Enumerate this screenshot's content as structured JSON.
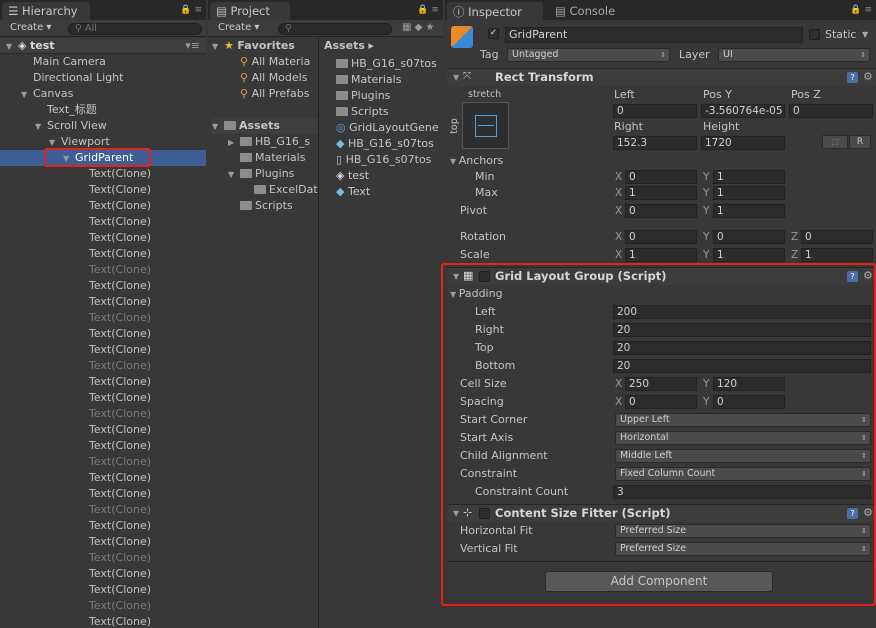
{
  "hierarchy": {
    "tab": "Hierarchy",
    "create": "Create",
    "search_placeholder": "All",
    "scene": "test",
    "items": {
      "main_camera": "Main Camera",
      "directional_light": "Directional Light",
      "canvas": "Canvas",
      "text_title": "Text_标题",
      "scroll_view": "Scroll View",
      "viewport": "Viewport",
      "grid_parent": "GridParent"
    },
    "clone_label": "Text(Clone)"
  },
  "project": {
    "tab": "Project",
    "create": "Create",
    "favorites": "Favorites",
    "fav_items": [
      "All Materia",
      "All Models",
      "All Prefabs"
    ],
    "assets": "Assets",
    "tree": [
      "HB_G16_s",
      "Materials",
      "Plugins",
      "ExcelDat",
      "Scripts"
    ],
    "breadcrumb": "Assets",
    "list": [
      "HB_G16_s07tos",
      "Materials",
      "Plugins",
      "Scripts",
      "GridLayoutGene",
      "HB_G16_s07tos",
      "HB_G16_s07tos",
      "test",
      "Text"
    ]
  },
  "inspector": {
    "tab": "Inspector",
    "console_tab": "Console",
    "object_name": "GridParent",
    "static_label": "Static",
    "tag_label": "Tag",
    "tag_value": "Untagged",
    "layer_label": "Layer",
    "layer_value": "UI",
    "rect": {
      "title": "Rect Transform",
      "stretch": "stretch",
      "top": "top",
      "col_left": "Left",
      "col_posy": "Pos Y",
      "col_posz": "Pos Z",
      "left": "0",
      "posy": "-3.560764e-05",
      "posz": "0",
      "col_right": "Right",
      "col_height": "Height",
      "right": "152.3",
      "height": "1720",
      "r_btn": "R",
      "anchors": "Anchors",
      "min": "Min",
      "max": "Max",
      "pivot": "Pivot",
      "rotation": "Rotation",
      "scale": "Scale",
      "min_x": "0",
      "min_y": "1",
      "max_x": "1",
      "max_y": "1",
      "pivot_x": "0",
      "pivot_y": "1",
      "rot_x": "0",
      "rot_y": "0",
      "rot_z": "0",
      "scale_x": "1",
      "scale_y": "1",
      "scale_z": "1"
    },
    "grid": {
      "title": "Grid Layout Group (Script)",
      "padding": "Padding",
      "left_label": "Left",
      "left": "200",
      "right_label": "Right",
      "right": "20",
      "top_label": "Top",
      "top": "20",
      "bottom_label": "Bottom",
      "bottom": "20",
      "cell_size": "Cell Size",
      "cell_x": "250",
      "cell_y": "120",
      "spacing": "Spacing",
      "spacing_x": "0",
      "spacing_y": "0",
      "start_corner": "Start Corner",
      "start_corner_value": "Upper Left",
      "start_axis": "Start Axis",
      "start_axis_value": "Horizontal",
      "child_alignment": "Child Alignment",
      "child_alignment_value": "Middle Left",
      "constraint": "Constraint",
      "constraint_value": "Fixed Column Count",
      "constraint_count": "Constraint Count",
      "constraint_count_value": "3"
    },
    "fitter": {
      "title": "Content Size Fitter (Script)",
      "horizontal": "Horizontal Fit",
      "horizontal_value": "Preferred Size",
      "vertical": "Vertical Fit",
      "vertical_value": "Preferred Size"
    },
    "axis": {
      "x": "X",
      "y": "Y",
      "z": "Z"
    },
    "add_component": "Add Component"
  },
  "colors": {
    "selection": "#3e5f96",
    "highlight": "#e8201c",
    "bg": "#383838"
  }
}
